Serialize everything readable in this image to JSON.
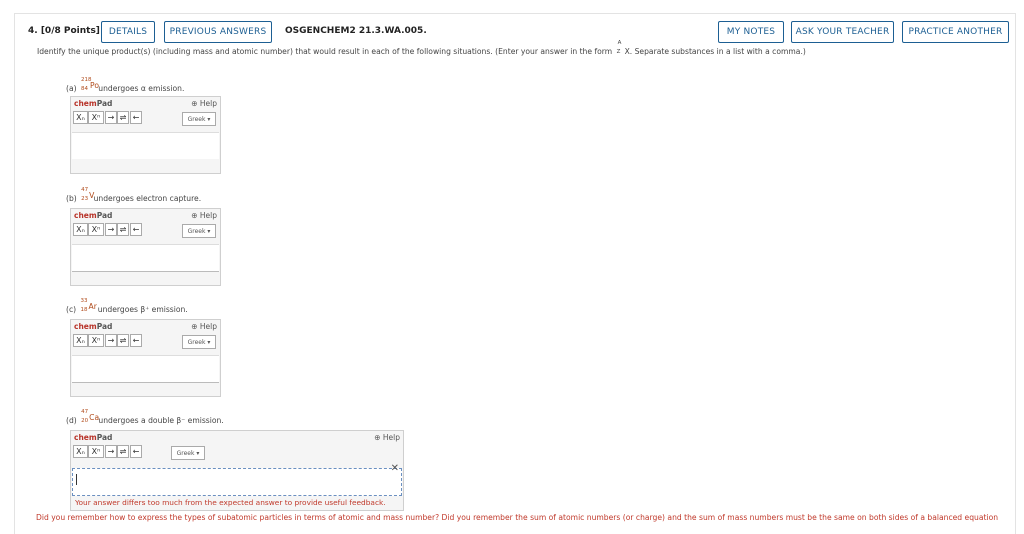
{
  "header": {
    "points": "4. [0/8 Points]",
    "details": "DETAILS",
    "previous_answers": "PREVIOUS ANSWERS",
    "question_id": "OSGENCHEM2 21.3.WA.005.",
    "my_notes": "MY NOTES",
    "ask_teacher": "ASK YOUR TEACHER",
    "practice_another": "PRACTICE ANOTHER"
  },
  "instructions": {
    "text": "Identify the unique product(s) (including mass and atomic number) that would result in each of the following situations. (Enter your answer in the form ",
    "form_a": "A",
    "form_z": "Z",
    "form_x": "X",
    "text_end": ". Separate substances in a list with a comma.)"
  },
  "parts": [
    {
      "label": "(a)",
      "mass": "218",
      "atomic": "84",
      "symbol": "Po",
      "text": "undergoes α emission."
    },
    {
      "label": "(b)",
      "mass": "47",
      "atomic": "23",
      "symbol": "V",
      "text": "undergoes electron capture."
    },
    {
      "label": "(c)",
      "mass": "33",
      "atomic": "18",
      "symbol": "Ar",
      "text": "undergoes β⁺ emission."
    },
    {
      "label": "(d)",
      "mass": "47",
      "atomic": "20",
      "symbol": "Ca",
      "text": "undergoes a double β⁻ emission."
    }
  ],
  "chempad": {
    "logo_chem": "chem",
    "logo_pad": "Pad",
    "help": "Help",
    "greek": "Greek ▾",
    "tools": [
      "Xₙ",
      "Xⁿ",
      "→",
      "⇌",
      "←"
    ]
  },
  "feedback": {
    "close_icon": "✕",
    "message": "Your answer differs too much from the expected answer to provide useful feedback."
  },
  "hint": "Did you remember how to express the types of subatomic particles in terms of atomic and mass number? Did you remember the sum of atomic numbers (or charge) and the sum of mass numbers must be the same on both sides of a balanced equation"
}
